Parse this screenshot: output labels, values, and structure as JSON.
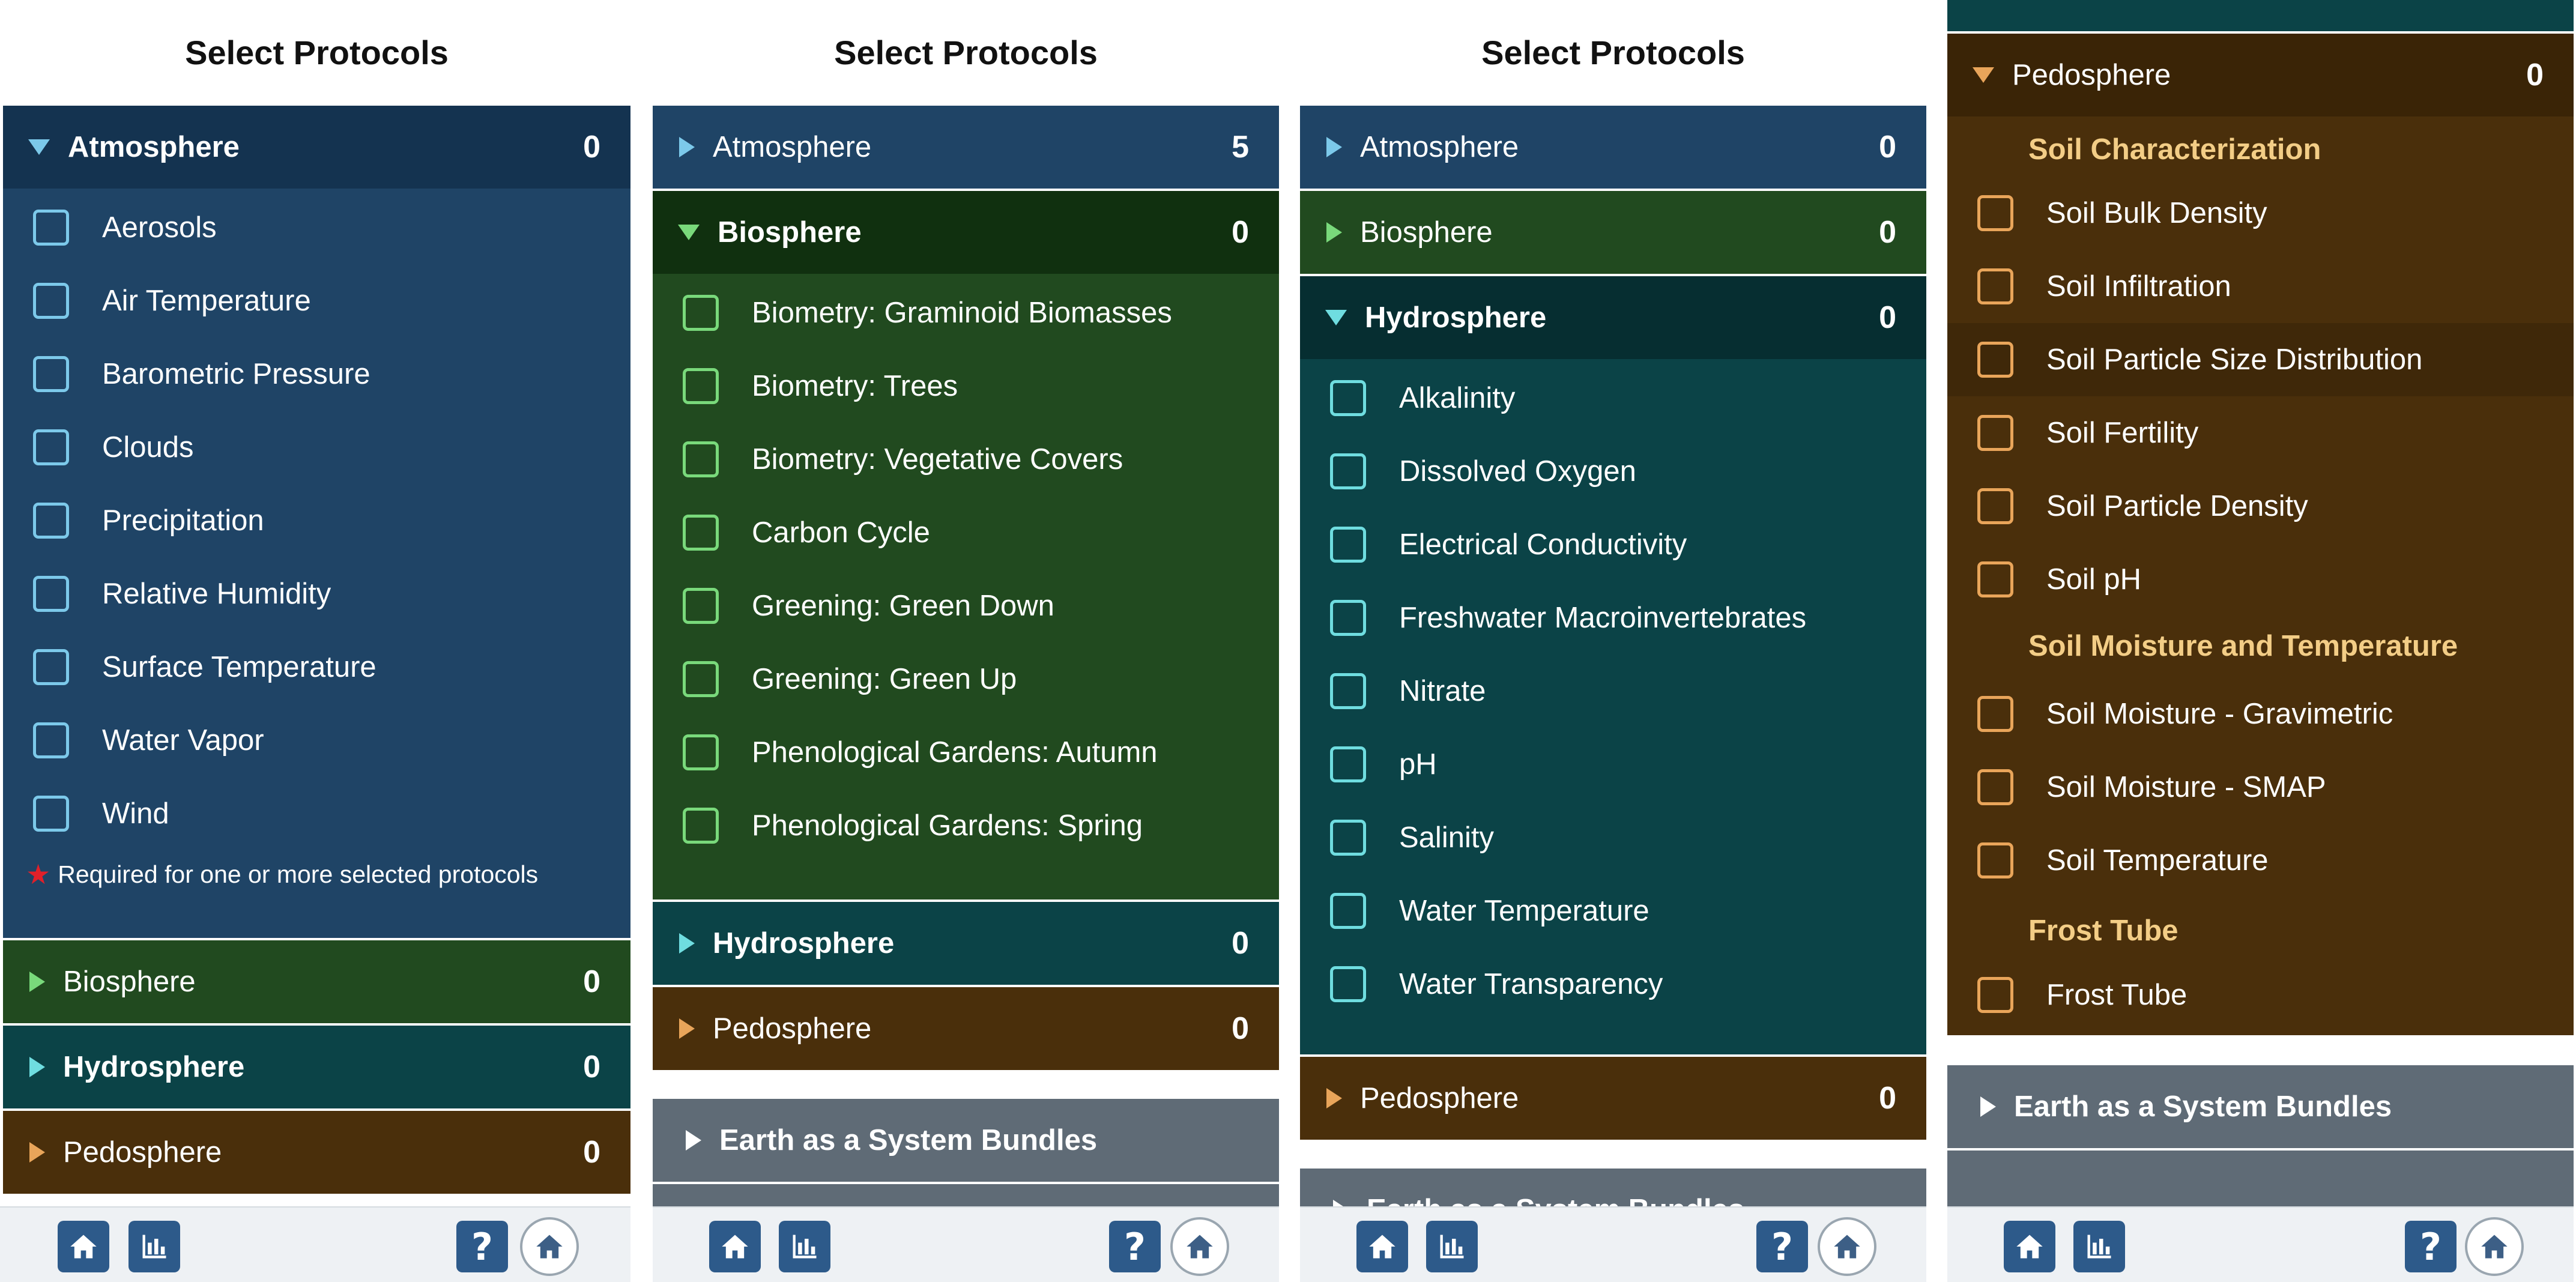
{
  "title": "Select Protocols",
  "bundles_label": "Earth as a System Bundles",
  "required_note": "Required for one or more selected protocols",
  "help_label": "?",
  "icons": {
    "home": "home-icon",
    "chart": "bar-chart-icon",
    "help": "help-icon",
    "globe": "globe-home-icon"
  },
  "colors": {
    "atmosphere": "#1f4466",
    "atmosphere_head": "#143350",
    "biosphere": "#214a1f",
    "biosphere_head": "#10300f",
    "hydrosphere": "#0b4347",
    "hydrosphere_head": "#062e31",
    "pedosphere": "#4a2f0b",
    "pedosphere_head": "#3a2406",
    "accent_blue": "#7cc9ea",
    "accent_green": "#79d97b",
    "accent_cyan": "#6fdde0",
    "accent_orange": "#e9a55a",
    "soil_subhead": "#f3cd86"
  },
  "panels": [
    {
      "atmosphere": {
        "label": "Atmosphere",
        "count": "0",
        "items": [
          "Aerosols",
          "Air Temperature",
          "Barometric Pressure",
          "Clouds",
          "Precipitation",
          "Relative Humidity",
          "Surface Temperature",
          "Water Vapor",
          "Wind"
        ]
      },
      "biosphere": {
        "label": "Biosphere",
        "count": "0"
      },
      "hydrosphere": {
        "label": "Hydrosphere",
        "count": "0"
      },
      "pedosphere": {
        "label": "Pedosphere",
        "count": "0"
      }
    },
    {
      "atmosphere": {
        "label": "Atmosphere",
        "count": "5"
      },
      "biosphere": {
        "label": "Biosphere",
        "count": "0",
        "items": [
          "Biometry: Graminoid Biomasses",
          "Biometry: Trees",
          "Biometry: Vegetative Covers",
          "Carbon Cycle",
          "Greening: Green Down",
          "Greening: Green Up",
          "Phenological Gardens: Autumn",
          "Phenological Gardens: Spring"
        ]
      },
      "hydrosphere": {
        "label": "Hydrosphere",
        "count": "0"
      },
      "pedosphere": {
        "label": "Pedosphere",
        "count": "0"
      }
    },
    {
      "atmosphere": {
        "label": "Atmosphere",
        "count": "0"
      },
      "biosphere": {
        "label": "Biosphere",
        "count": "0"
      },
      "hydrosphere": {
        "label": "Hydrosphere",
        "count": "0",
        "items": [
          "Alkalinity",
          "Dissolved Oxygen",
          "Electrical Conductivity",
          "Freshwater Macroinvertebrates",
          "Nitrate",
          "pH",
          "Salinity",
          "Water Temperature",
          "Water Transparency"
        ]
      },
      "pedosphere": {
        "label": "Pedosphere",
        "count": "0"
      }
    },
    {
      "pedosphere": {
        "label": "Pedosphere",
        "count": "0",
        "groups": [
          {
            "label": "Soil Characterization",
            "items": [
              "Soil Bulk Density",
              "Soil Infiltration",
              "Soil Particle Size Distribution",
              "Soil Fertility",
              "Soil Particle Density",
              "Soil pH"
            ]
          },
          {
            "label": "Soil Moisture and Temperature",
            "items": [
              "Soil Moisture - Gravimetric",
              "Soil Moisture - SMAP",
              "Soil Temperature"
            ]
          },
          {
            "label": "Frost Tube",
            "items": [
              "Frost Tube"
            ]
          }
        ]
      }
    }
  ]
}
